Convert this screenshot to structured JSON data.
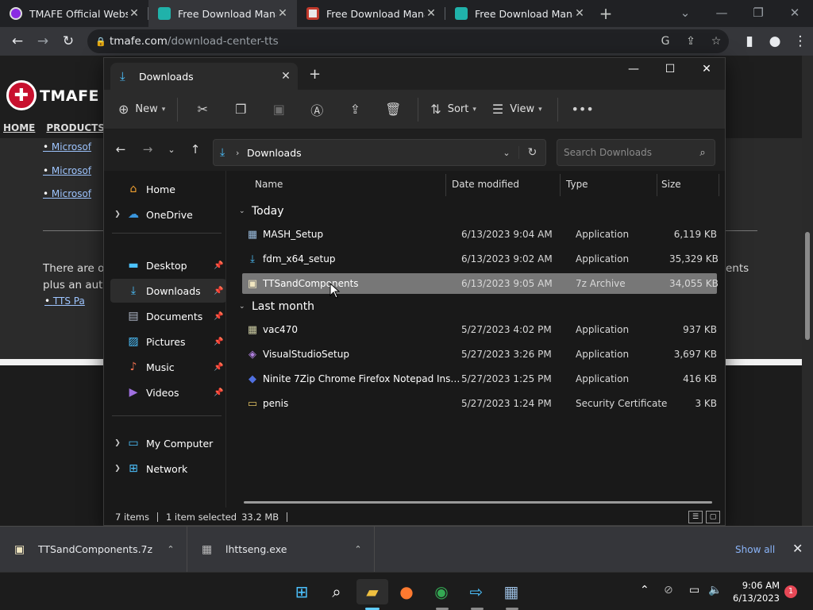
{
  "browser": {
    "tabs": [
      {
        "title": "TMAFE Official Website",
        "color": "#8a2be2"
      },
      {
        "title": "Free Download Manag",
        "color": "#20b2aa"
      },
      {
        "title": "Free Download Manag",
        "color": "#e8e8e8"
      },
      {
        "title": "Free Download Manag",
        "color": "#20b2aa"
      }
    ],
    "url_host": "tmafe.com",
    "url_path": "/download-center-tts"
  },
  "website": {
    "logo_text": "TMAFE",
    "nav": [
      "HOME",
      "PRODUCTS"
    ],
    "list_items": [
      "Microsof",
      "Microsof",
      "Microsof"
    ],
    "text_line1": "There are ov",
    "text_line2": "plus an auto",
    "text_right": "ents",
    "link": "TTS Pa"
  },
  "explorer": {
    "tab_title": "Downloads",
    "commands": {
      "new": "New",
      "sort": "Sort",
      "view": "View"
    },
    "address": "Downloads",
    "search_placeholder": "Search Downloads",
    "nav": {
      "home": "Home",
      "onedrive": "OneDrive",
      "desktop": "Desktop",
      "downloads": "Downloads",
      "documents": "Documents",
      "pictures": "Pictures",
      "music": "Music",
      "videos": "Videos",
      "mycomputer": "My Computer",
      "network": "Network"
    },
    "columns": {
      "name": "Name",
      "date": "Date modified",
      "type": "Type",
      "size": "Size"
    },
    "groups": {
      "today": "Today",
      "lastmonth": "Last month"
    },
    "files": [
      {
        "name": "MASH_Setup",
        "date": "6/13/2023 9:04 AM",
        "type": "Application",
        "size": "6,119 KB"
      },
      {
        "name": "fdm_x64_setup",
        "date": "6/13/2023 9:02 AM",
        "type": "Application",
        "size": "35,329 KB"
      },
      {
        "name": "TTSandComponents",
        "date": "6/13/2023 9:05 AM",
        "type": "7z Archive",
        "size": "34,055 KB"
      },
      {
        "name": "vac470",
        "date": "5/27/2023 4:02 PM",
        "type": "Application",
        "size": "937 KB"
      },
      {
        "name": "VisualStudioSetup",
        "date": "5/27/2023 3:26 PM",
        "type": "Application",
        "size": "3,697 KB"
      },
      {
        "name": "Ninite 7Zip Chrome Firefox Notepad Inst...",
        "date": "5/27/2023 1:25 PM",
        "type": "Application",
        "size": "416 KB"
      },
      {
        "name": "penis",
        "date": "5/27/2023 1:24 PM",
        "type": "Security Certificate",
        "size": "3 KB"
      }
    ],
    "status": {
      "items": "7 items",
      "selected": "1 item selected",
      "size": "33.2 MB"
    }
  },
  "downloads_bar": {
    "items": [
      "TTSandComponents.7z",
      "lhttseng.exe"
    ],
    "show_all": "Show all"
  },
  "taskbar": {
    "time": "9:06 AM",
    "date": "6/13/2023",
    "notifications": "1"
  },
  "colors": {
    "accent": "#60cdff",
    "selection": "#777777"
  }
}
